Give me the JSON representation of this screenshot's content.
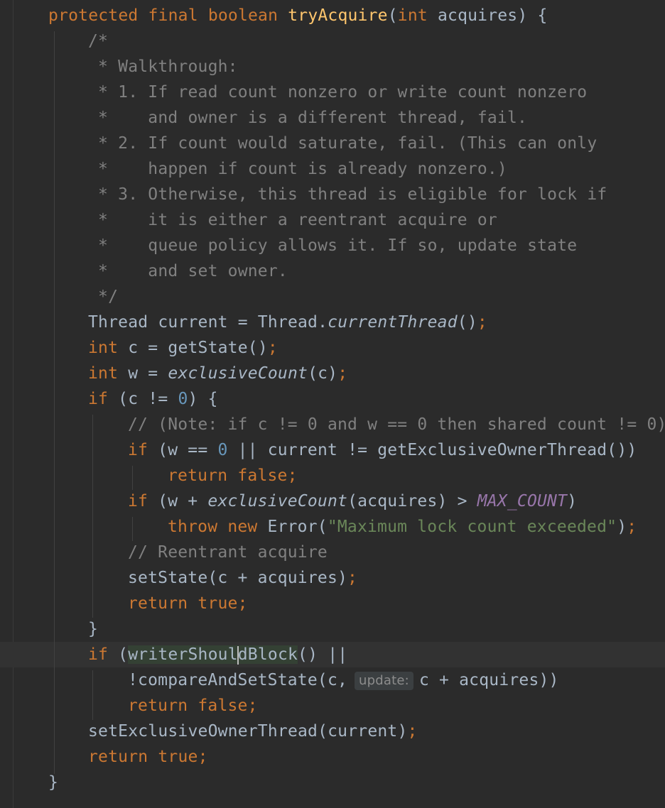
{
  "code": {
    "l1": {
      "k1": "protected",
      "k2": "final",
      "k3": "boolean",
      "fn": "tryAcquire",
      "p1": "(",
      "k4": "int",
      "p2": " acquires) {"
    },
    "l2": "/*",
    "l3": " * Walkthrough:",
    "l4": " * 1. If read count nonzero or write count nonzero",
    "l5": " *    and owner is a different thread, fail.",
    "l6": " * 2. If count would saturate, fail. (This can only",
    "l7": " *    happen if count is already nonzero.)",
    "l8": " * 3. Otherwise, this thread is eligible for lock if",
    "l9": " *    it is either a reentrant acquire or",
    "l10": " *    queue policy allows it. If so, update state",
    "l11": " *    and set owner.",
    "l12": " */",
    "l13": {
      "a": "Thread current = Thread.",
      "b": "currentThread",
      "c": "()",
      "d": ";"
    },
    "l14": {
      "k": "int",
      "a": " c = getState()",
      "d": ";"
    },
    "l15": {
      "k": "int",
      "a": " w = ",
      "b": "exclusiveCount",
      "c": "(c)",
      "d": ";"
    },
    "l16": {
      "k": "if",
      "a": " (c != ",
      "n": "0",
      "b": ") {"
    },
    "l17": "// (Note: if c != 0 and w == 0 then shared count != 0)",
    "l18": {
      "k": "if",
      "a": " (w == ",
      "n": "0",
      "b": " || current != getExclusiveOwnerThread())"
    },
    "l19": {
      "k1": "return",
      "k2": "false",
      "d": ";"
    },
    "l20": {
      "k": "if",
      "a": " (w + ",
      "b": "exclusiveCount",
      "c": "(acquires) > ",
      "const": "MAX_COUNT",
      "e": ")"
    },
    "l21": {
      "k1": "throw",
      "k2": "new",
      "a": " Error(",
      "s": "\"Maximum lock count exceeded\"",
      "b": ")",
      "d": ";"
    },
    "l22": "// Reentrant acquire",
    "l23": {
      "a": "setState(c + acquires)",
      "d": ";"
    },
    "l24": {
      "k1": "return",
      "k2": "true",
      "d": ";"
    },
    "l25": "}",
    "l26": {
      "k": "if",
      "a": " (",
      "b1": "writerShoul",
      "b2": "dBlock",
      "c": "() ||"
    },
    "l27": {
      "a": "!compareAndSetState(c,",
      "hint": "update:",
      "b": "c + acquires))"
    },
    "l28": {
      "k1": "return",
      "k2": "false",
      "d": ";"
    },
    "l29": {
      "a": "setExclusiveOwnerThread(current)",
      "d": ";"
    },
    "l30": {
      "k1": "return",
      "k2": "true",
      "d": ";"
    },
    "l31": "}"
  }
}
